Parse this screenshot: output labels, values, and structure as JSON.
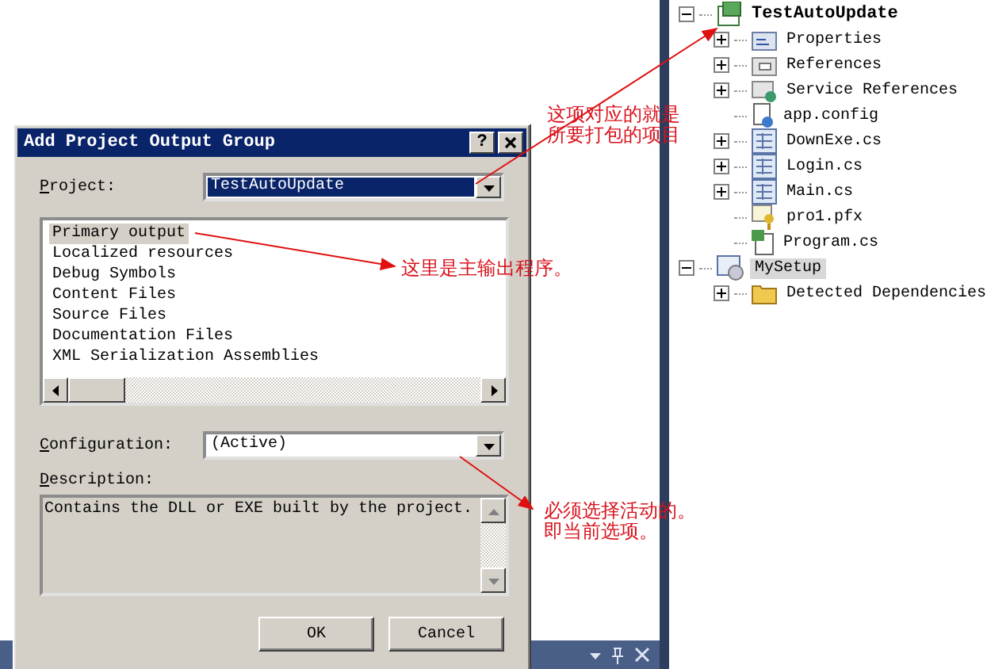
{
  "dialog": {
    "title": "Add Project Output Group",
    "help_button": "?",
    "project": {
      "label": "Project:",
      "value": "TestAutoUpdate"
    },
    "outputs": [
      {
        "label": "Primary output",
        "selected": true
      },
      {
        "label": "Localized resources",
        "selected": false
      },
      {
        "label": "Debug Symbols",
        "selected": false
      },
      {
        "label": "Content Files",
        "selected": false
      },
      {
        "label": "Source Files",
        "selected": false
      },
      {
        "label": "Documentation Files",
        "selected": false
      },
      {
        "label": "XML Serialization Assemblies",
        "selected": false
      }
    ],
    "configuration": {
      "label": "Configuration:",
      "value": "(Active)"
    },
    "description": {
      "label": "Description:",
      "text": "Contains the DLL or EXE built by the project."
    },
    "buttons": [
      "OK",
      "Cancel"
    ]
  },
  "tree": [
    {
      "label": "TestAutoUpdate",
      "kind": "csproj",
      "expanded": true,
      "selected": false,
      "children": [
        {
          "label": "Properties",
          "kind": "properties",
          "expanded": false,
          "selected": false
        },
        {
          "label": "References",
          "kind": "references",
          "expanded": false,
          "selected": false
        },
        {
          "label": "Service References",
          "kind": "service",
          "expanded": false,
          "selected": false
        },
        {
          "label": "app.config",
          "kind": "config",
          "selected": false
        },
        {
          "label": "DownExe.cs",
          "kind": "form",
          "expanded": false,
          "selected": false
        },
        {
          "label": "Login.cs",
          "kind": "form",
          "expanded": false,
          "selected": false
        },
        {
          "label": "Main.cs",
          "kind": "form",
          "expanded": false,
          "selected": false
        },
        {
          "label": "pro1.pfx",
          "kind": "key",
          "selected": false
        },
        {
          "label": "Program.cs",
          "kind": "cs",
          "selected": false
        }
      ]
    },
    {
      "label": "MySetup",
      "kind": "setup",
      "expanded": true,
      "selected": true,
      "children": [
        {
          "label": "Detected Dependencies",
          "kind": "folder",
          "expanded": false,
          "selected": false
        }
      ]
    }
  ],
  "annotations": [
    {
      "lines": [
        "这项对应的就是",
        "所要打包的项目"
      ]
    },
    {
      "lines": [
        "这里是主输出程序。"
      ]
    },
    {
      "lines": [
        "必须选择活动的。",
        "即当前选项。"
      ]
    }
  ]
}
